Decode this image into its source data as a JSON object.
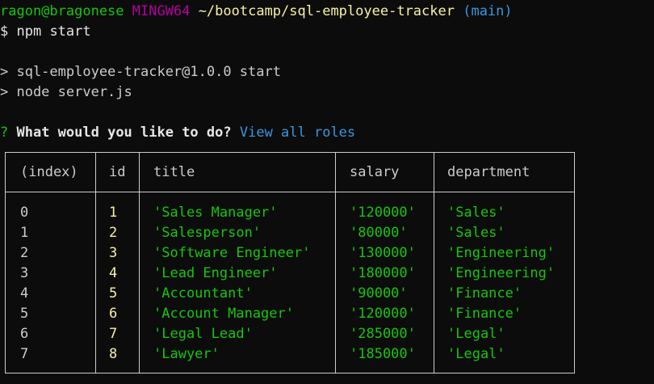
{
  "prompt": {
    "user_host": "ragon@bragonese",
    "system": "MINGW64",
    "path": "~/bootcamp/sql-employee-tracker",
    "branch": "(main)",
    "symbol": "$",
    "command": "npm start"
  },
  "output": {
    "line1": "> sql-employee-tracker@1.0.0 start",
    "line2": "> node server.js"
  },
  "question": {
    "mark": "?",
    "text": "What would you like to do?",
    "answer": "View all roles"
  },
  "table": {
    "headers": [
      "(index)",
      "id",
      "title",
      "salary",
      "department"
    ],
    "rows": [
      {
        "index": "0",
        "id": "1",
        "title": "'Sales Manager'",
        "salary": "'120000'",
        "department": "'Sales'"
      },
      {
        "index": "1",
        "id": "2",
        "title": "'Salesperson'",
        "salary": "'80000'",
        "department": "'Sales'"
      },
      {
        "index": "2",
        "id": "3",
        "title": "'Software Engineer'",
        "salary": "'130000'",
        "department": "'Engineering'"
      },
      {
        "index": "3",
        "id": "4",
        "title": "'Lead Engineer'",
        "salary": "'180000'",
        "department": "'Engineering'"
      },
      {
        "index": "4",
        "id": "5",
        "title": "'Accountant'",
        "salary": "'90000'",
        "department": "'Finance'"
      },
      {
        "index": "5",
        "id": "6",
        "title": "'Account Manager'",
        "salary": "'120000'",
        "department": "'Finance'"
      },
      {
        "index": "6",
        "id": "7",
        "title": "'Legal Lead'",
        "salary": "'285000'",
        "department": "'Legal'"
      },
      {
        "index": "7",
        "id": "8",
        "title": "'Lawyer'",
        "salary": "'185000'",
        "department": "'Legal'"
      }
    ]
  },
  "colors": {
    "background": "#0c0c0c",
    "text": "#cccccc",
    "green": "#16c60c",
    "magenta": "#b4009e",
    "yellow": "#f9f1a5",
    "cyan": "#3a96dd"
  }
}
